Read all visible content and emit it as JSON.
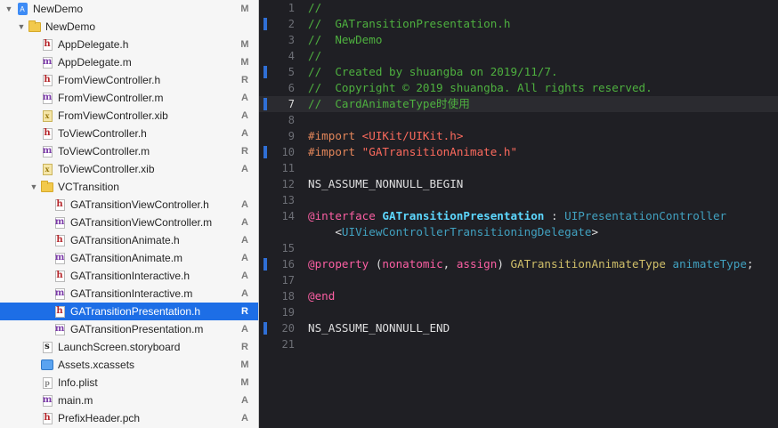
{
  "navigator": {
    "items": [
      {
        "label": "NewDemo",
        "status": "M",
        "kind": "project",
        "depth": 0,
        "expanded": true
      },
      {
        "label": "NewDemo",
        "status": "",
        "kind": "folder",
        "depth": 1,
        "expanded": true
      },
      {
        "label": "AppDelegate.h",
        "status": "M",
        "kind": "h",
        "depth": 2
      },
      {
        "label": "AppDelegate.m",
        "status": "M",
        "kind": "m",
        "depth": 2
      },
      {
        "label": "FromViewController.h",
        "status": "R",
        "kind": "h",
        "depth": 2
      },
      {
        "label": "FromViewController.m",
        "status": "A",
        "kind": "m",
        "depth": 2
      },
      {
        "label": "FromViewController.xib",
        "status": "A",
        "kind": "xib",
        "depth": 2
      },
      {
        "label": "ToViewController.h",
        "status": "A",
        "kind": "h",
        "depth": 2
      },
      {
        "label": "ToViewController.m",
        "status": "R",
        "kind": "m",
        "depth": 2
      },
      {
        "label": "ToViewController.xib",
        "status": "A",
        "kind": "xib",
        "depth": 2
      },
      {
        "label": "VCTransition",
        "status": "",
        "kind": "folder",
        "depth": 2,
        "expanded": true
      },
      {
        "label": "GATransitionViewController.h",
        "status": "A",
        "kind": "h",
        "depth": 3
      },
      {
        "label": "GATransitionViewController.m",
        "status": "A",
        "kind": "m",
        "depth": 3
      },
      {
        "label": "GATransitionAnimate.h",
        "status": "A",
        "kind": "h",
        "depth": 3
      },
      {
        "label": "GATransitionAnimate.m",
        "status": "A",
        "kind": "m",
        "depth": 3
      },
      {
        "label": "GATransitionInteractive.h",
        "status": "A",
        "kind": "h",
        "depth": 3
      },
      {
        "label": "GATransitionInteractive.m",
        "status": "A",
        "kind": "m",
        "depth": 3
      },
      {
        "label": "GATransitionPresentation.h",
        "status": "R",
        "kind": "h",
        "depth": 3,
        "selected": true
      },
      {
        "label": "GATransitionPresentation.m",
        "status": "A",
        "kind": "m",
        "depth": 3
      },
      {
        "label": "LaunchScreen.storyboard",
        "status": "R",
        "kind": "storyboard",
        "depth": 2
      },
      {
        "label": "Assets.xcassets",
        "status": "M",
        "kind": "assets",
        "depth": 2
      },
      {
        "label": "Info.plist",
        "status": "M",
        "kind": "plist",
        "depth": 2
      },
      {
        "label": "main.m",
        "status": "A",
        "kind": "m",
        "depth": 2
      },
      {
        "label": "PrefixHeader.pch",
        "status": "A",
        "kind": "pch",
        "depth": 2
      }
    ]
  },
  "editor": {
    "current_line": 7,
    "lines": [
      {
        "n": "1",
        "tokens": [
          {
            "t": "//",
            "c": "comment"
          }
        ]
      },
      {
        "n": "2",
        "tokens": [
          {
            "t": "//  GATransitionPresentation.h",
            "c": "comment"
          }
        ],
        "changed": true
      },
      {
        "n": "3",
        "tokens": [
          {
            "t": "//  NewDemo",
            "c": "comment"
          }
        ]
      },
      {
        "n": "4",
        "tokens": [
          {
            "t": "//",
            "c": "comment"
          }
        ]
      },
      {
        "n": "5",
        "tokens": [
          {
            "t": "//  Created by shuangba on 2019/11/7.",
            "c": "comment"
          }
        ],
        "changed": true
      },
      {
        "n": "6",
        "tokens": [
          {
            "t": "//  Copyright © 2019 shuangba. All rights reserved.",
            "c": "comment"
          }
        ]
      },
      {
        "n": "7",
        "tokens": [
          {
            "t": "//  CardAnimateType时使用",
            "c": "comment"
          }
        ],
        "changed": true
      },
      {
        "n": "8",
        "tokens": []
      },
      {
        "n": "9",
        "tokens": [
          {
            "t": "#import ",
            "c": "pre"
          },
          {
            "t": "<UIKit/UIKit.h>",
            "c": "str"
          }
        ]
      },
      {
        "n": "10",
        "tokens": [
          {
            "t": "#import ",
            "c": "pre"
          },
          {
            "t": "\"GATransitionAnimate.h\"",
            "c": "str"
          }
        ],
        "changed": true
      },
      {
        "n": "11",
        "tokens": []
      },
      {
        "n": "12",
        "tokens": [
          {
            "t": "NS_ASSUME_NONNULL_BEGIN",
            "c": "plain"
          }
        ]
      },
      {
        "n": "13",
        "tokens": []
      },
      {
        "n": "14",
        "tokens": [
          {
            "t": "@interface ",
            "c": "kw"
          },
          {
            "t": "GATransitionPresentation",
            "c": "type"
          },
          {
            "t": " : ",
            "c": "plain"
          },
          {
            "t": "UIPresentationController",
            "c": "type2"
          }
        ]
      },
      {
        "n": "",
        "tokens": [
          {
            "t": "    <",
            "c": "plain"
          },
          {
            "t": "UIViewControllerTransitioningDelegate",
            "c": "type2"
          },
          {
            "t": ">",
            "c": "plain"
          }
        ]
      },
      {
        "n": "15",
        "tokens": []
      },
      {
        "n": "16",
        "tokens": [
          {
            "t": "@property ",
            "c": "kw"
          },
          {
            "t": "(",
            "c": "plain"
          },
          {
            "t": "nonatomic",
            "c": "kw"
          },
          {
            "t": ", ",
            "c": "plain"
          },
          {
            "t": "assign",
            "c": "kw"
          },
          {
            "t": ") ",
            "c": "plain"
          },
          {
            "t": "GATransitionAnimateType",
            "c": "ptype"
          },
          {
            "t": " ",
            "c": "plain"
          },
          {
            "t": "animateType",
            "c": "type2"
          },
          {
            "t": ";",
            "c": "plain"
          }
        ],
        "changed": true
      },
      {
        "n": "17",
        "tokens": []
      },
      {
        "n": "18",
        "tokens": [
          {
            "t": "@end",
            "c": "kw"
          }
        ]
      },
      {
        "n": "19",
        "tokens": []
      },
      {
        "n": "20",
        "tokens": [
          {
            "t": "NS_ASSUME_NONNULL_END",
            "c": "plain"
          }
        ],
        "changed": true
      },
      {
        "n": "21",
        "tokens": []
      }
    ]
  }
}
